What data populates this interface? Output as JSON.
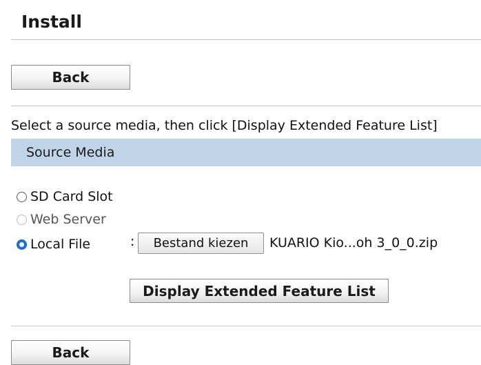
{
  "page": {
    "title": "Install"
  },
  "buttons": {
    "back_top": "Back",
    "back_bottom": "Back",
    "display_list": "Display Extended Feature List"
  },
  "instruction": "Select a source media, then click [Display Extended Feature List]",
  "source_media": {
    "header": "Source Media",
    "options": [
      {
        "label": "SD Card Slot",
        "checked": false,
        "disabled": false
      },
      {
        "label": "Web Server",
        "checked": false,
        "disabled": true
      },
      {
        "label": "Local File",
        "checked": true,
        "disabled": false
      }
    ],
    "separator": ":",
    "file_button": "Bestand kiezen",
    "file_name": "KUARIO Kio...oh 3_0_0.zip"
  },
  "colors": {
    "header_bg": "#bfd3e9",
    "radio_checked": "#1a6fd1"
  }
}
